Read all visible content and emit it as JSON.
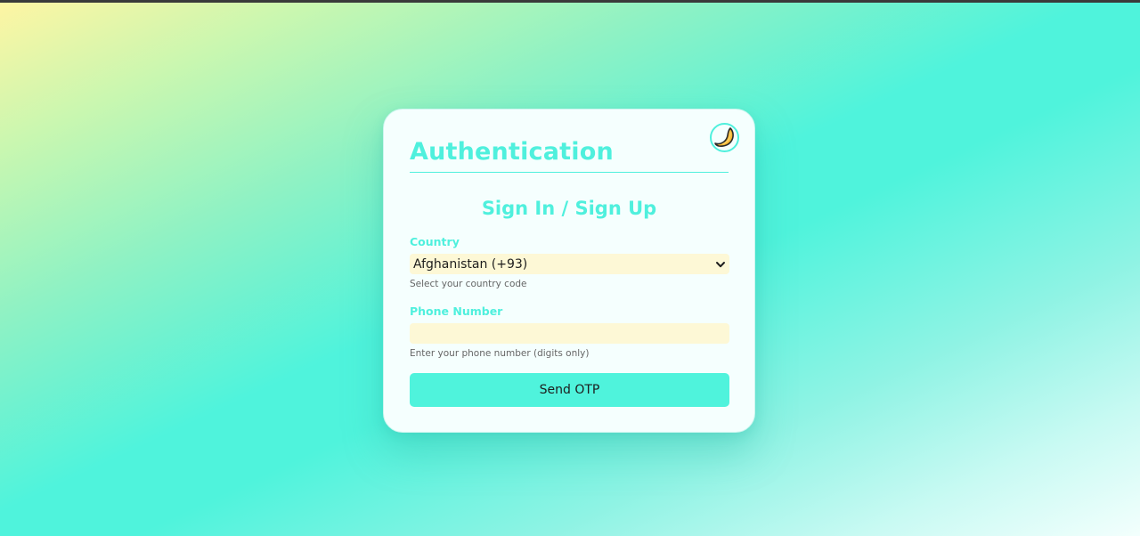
{
  "auth_card": {
    "title": "Authentication",
    "subtitle": "Sign In / Sign Up",
    "theme_toggle_icon": "crescent-moon-icon",
    "country": {
      "label": "Country",
      "selected_value": "Afghanistan (+93)",
      "hint": "Select your country code"
    },
    "phone": {
      "label": "Phone Number",
      "value": "",
      "hint": "Enter your phone number (digits only)"
    },
    "submit_label": "Send OTP"
  },
  "colors": {
    "accent": "#4ff0dd",
    "button": "#4ff3dc",
    "input_background": "#fdf8d6",
    "card_background": "#f5fffe",
    "moon": "#f7b733"
  }
}
